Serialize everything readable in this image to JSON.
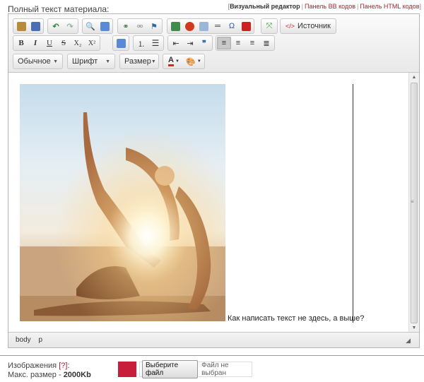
{
  "form": {
    "field_label": "Полный текст материала:",
    "modes": {
      "visual": "Визуальный редактор",
      "bb": "Панель BB кодов",
      "html": "Панель HTML кодов",
      "separator": "|",
      "open_bracket": "[",
      "close_bracket": "]"
    }
  },
  "toolbar": {
    "source_label": "Источник",
    "format_combo": "Обычное",
    "font_combo": "Шрифт",
    "size_combo": "Размер",
    "bold": "B",
    "italic": "I",
    "underline": "U",
    "strike": "S",
    "subscript": "X₂",
    "superscript": "X²",
    "blockquote": "❞",
    "text_color_glyph": "A"
  },
  "content": {
    "caption": "Как написать текст не здесь, а выше?"
  },
  "statusbar": {
    "path_body": "body",
    "path_p": "p"
  },
  "upload": {
    "label": "Изображения",
    "help": "[?]",
    "label_colon": ":",
    "max_size_label": "Макс. размер -",
    "max_size_value": "2000Kb",
    "choose_button": "Выберите файл",
    "no_file": "Файл не выбран"
  },
  "colors": {
    "accent_red": "#c81e3c",
    "link_red": "#aa2233",
    "active_button": "#c9c9c9"
  }
}
